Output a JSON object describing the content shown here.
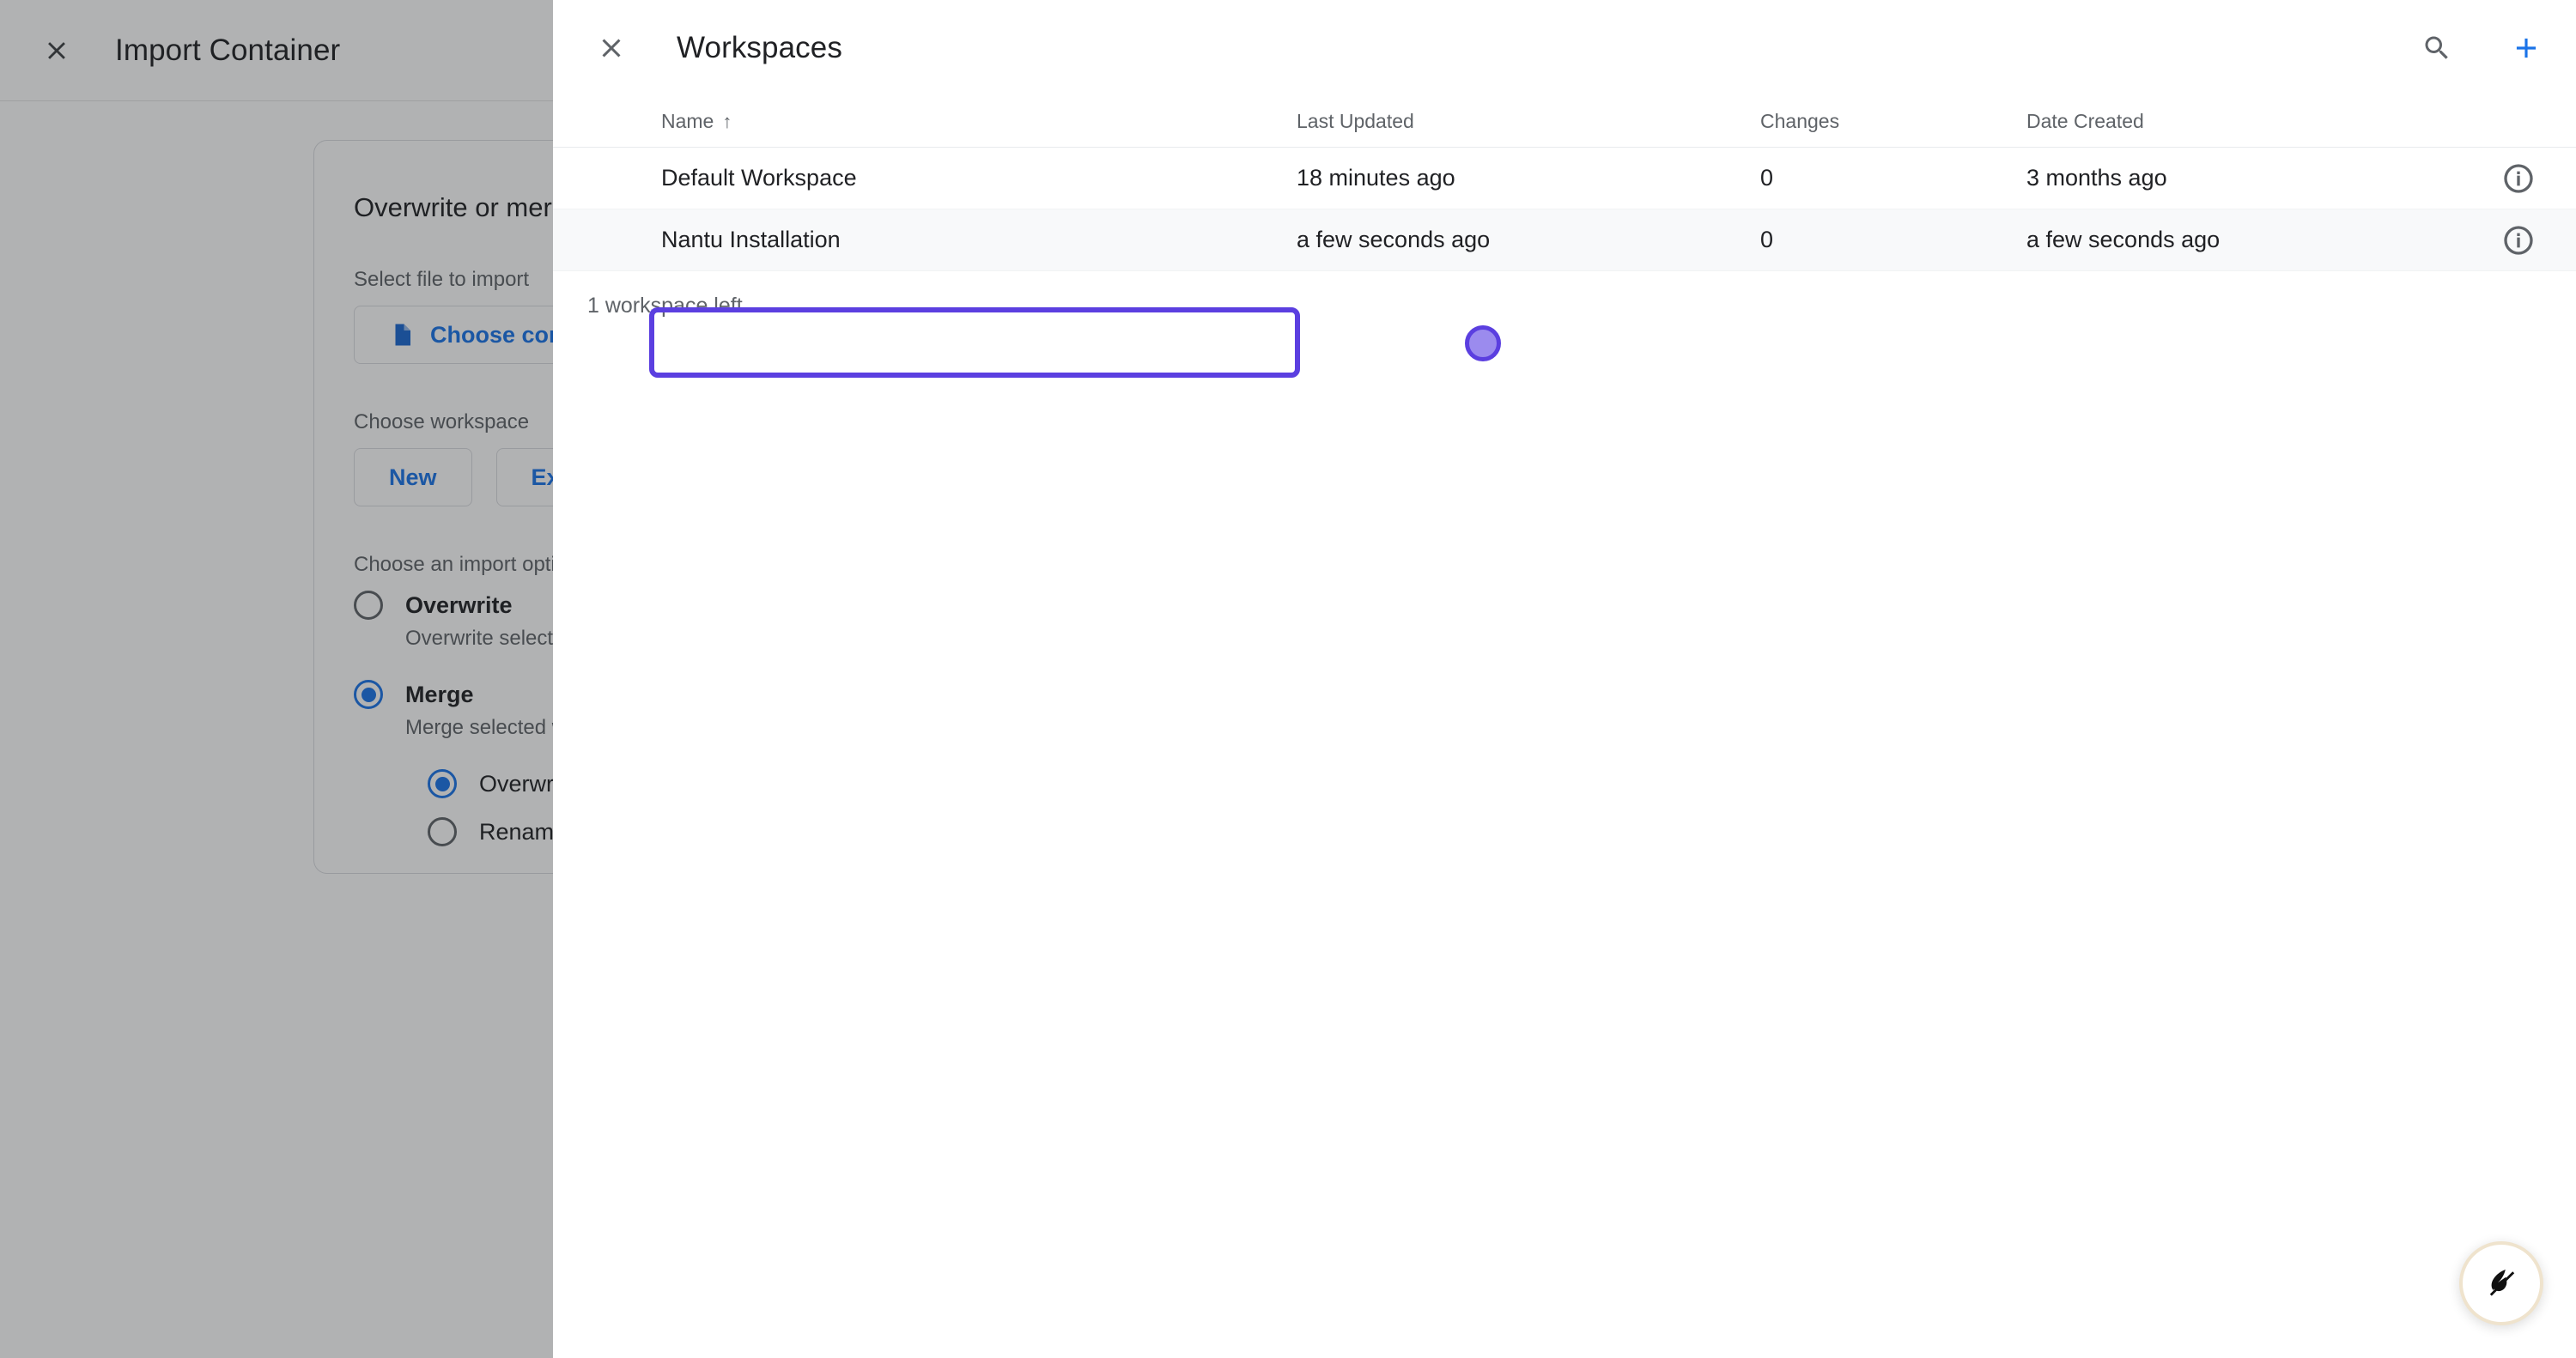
{
  "background_page": {
    "title": "Import Container",
    "close_icon": "close-icon",
    "card": {
      "heading": "Overwrite or merge workspace",
      "select_file_label": "Select file to import",
      "choose_container_button": "Choose container file",
      "choose_container_icon": "document-icon",
      "choose_workspace_label": "Choose workspace",
      "workspace_buttons": [
        "New",
        "Existing"
      ],
      "import_option_label": "Choose an import option",
      "options": [
        {
          "label": "Overwrite",
          "description": "Overwrite selected workspace",
          "selected": false
        },
        {
          "label": "Merge",
          "description": "Merge selected workspace",
          "selected": true
        }
      ],
      "merge_sub_options": [
        {
          "label": "Overwrite conflicting tags, triggers, and variables",
          "selected": true
        },
        {
          "label": "Rename conflicting tags, triggers, and variables",
          "selected": false
        }
      ]
    }
  },
  "workspaces_panel": {
    "title": "Workspaces",
    "close_icon": "close-icon",
    "search_icon": "search-icon",
    "add_icon": "plus-icon",
    "accent_color": "#1a73e8",
    "selection_color": "#5b3fe0",
    "table": {
      "columns": [
        {
          "key": "name",
          "label": "Name",
          "sort": "↑"
        },
        {
          "key": "updated",
          "label": "Last Updated",
          "sort": ""
        },
        {
          "key": "changes",
          "label": "Changes",
          "sort": ""
        },
        {
          "key": "created",
          "label": "Date Created",
          "sort": ""
        }
      ],
      "rows": [
        {
          "name": "Default Workspace",
          "updated": "18 minutes ago",
          "changes": "0",
          "created": "3 months ago",
          "info_icon": "info-icon",
          "selected": false
        },
        {
          "name": "Nantu Installation",
          "updated": "a few seconds ago",
          "changes": "0",
          "created": "a few seconds ago",
          "info_icon": "info-icon",
          "selected": true
        }
      ]
    },
    "footnote": "1 workspace left"
  },
  "floating_button": {
    "icon": "feather-icon"
  }
}
